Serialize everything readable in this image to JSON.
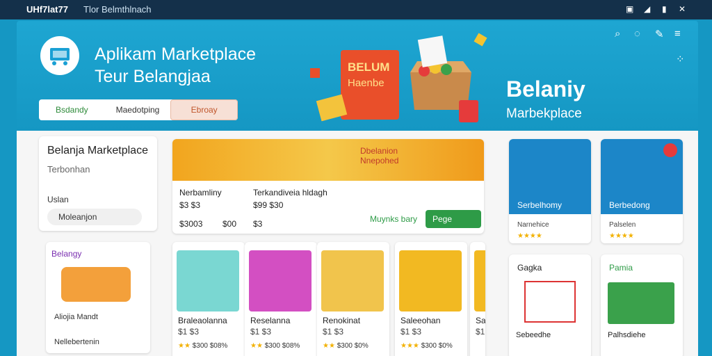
{
  "window": {
    "title": "UHf7lat77",
    "subtitle": "Tlor Belmthlnach"
  },
  "hero": {
    "title_line1": "Aplikam Marketplace",
    "title_line2": "Teur Belangjaa",
    "tabs": [
      "Bsdandy",
      "Maedotping",
      "Ebroay"
    ],
    "right_big": "Belaniy",
    "right_small": "Marbekplace"
  },
  "left_card": {
    "title": "Belanja Marketplace",
    "sub": "Terbonhan",
    "label": "Uslan",
    "button": "Moleanjon"
  },
  "promo": {
    "banner_text": "Dbelanion Nnepohed",
    "col1_title": "Nerbamliny",
    "col1_price": "$3 $3",
    "col1_rating": "$3003",
    "col1_extra": "$00",
    "col2_title": "Terkandiveia hldagh",
    "col2_price": "$99 $30",
    "col2_rating": "$3",
    "link": "Muynks bary",
    "button": "Pege"
  },
  "small_card": {
    "badge": "Belangy",
    "row1": "Aliojia Mandt",
    "row2": "Nellebertenin"
  },
  "products": [
    {
      "name": "Braleaolanna",
      "price": "$1 $3",
      "rating": "$300",
      "price2": "$08%"
    },
    {
      "name": "Reselanna",
      "price": "$1 $3",
      "rating": "$300",
      "price2": "$08%"
    },
    {
      "name": "Renokinat",
      "price": "$1 $3",
      "rating": "$300",
      "price2": "$0%"
    },
    {
      "name": "Saleeohan",
      "price": "$1 $3",
      "rating": "$300",
      "price2": "$0%"
    },
    {
      "name": "Sa",
      "price": "$1",
      "rating": "",
      "price2": ""
    }
  ],
  "right_cards": [
    {
      "label": "Serbelhomy",
      "s1": "Narnehice",
      "s2": "",
      "color": "#1c86c8"
    },
    {
      "label": "Berbedong",
      "s1": "Palselen",
      "s2": "",
      "color": "#1c86c8"
    }
  ],
  "right_cards2": [
    {
      "title": "Gagka",
      "name": "Sebeedhe"
    },
    {
      "title": "Pamia",
      "name": "Palhsdiehe"
    }
  ]
}
